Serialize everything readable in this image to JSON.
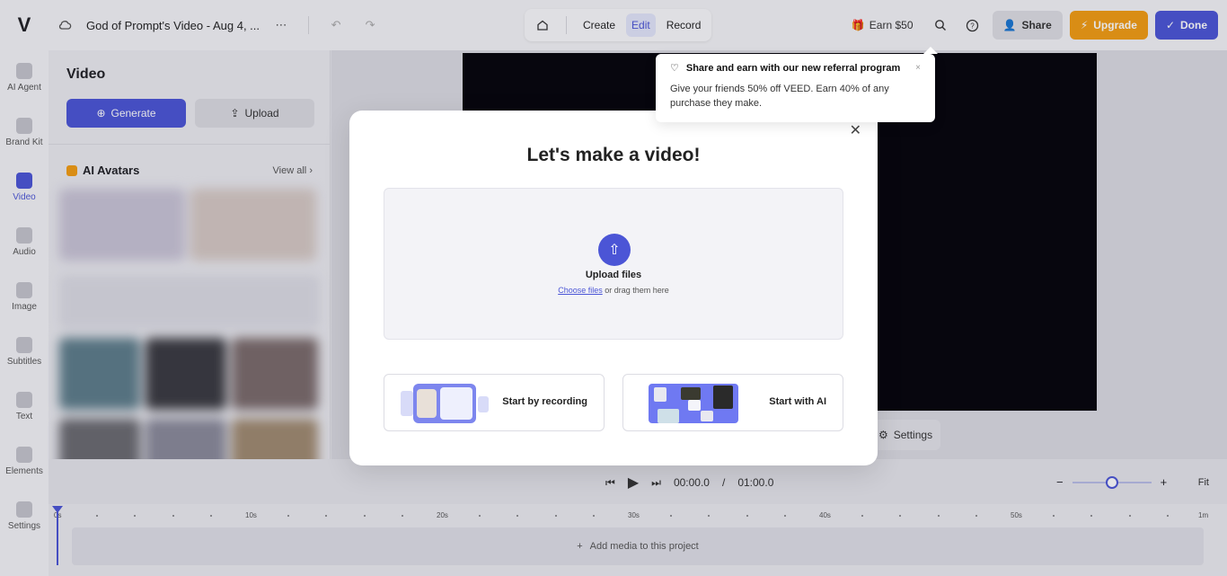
{
  "topbar": {
    "logo": "V",
    "project_title": "God of Prompt's Video - Aug 4, ...",
    "modes": [
      "Create",
      "Edit",
      "Record"
    ],
    "active_mode": "Edit",
    "earn_label": "Earn $50",
    "share_label": "Share",
    "upgrade_label": "Upgrade",
    "done_label": "Done"
  },
  "rail": [
    {
      "label": "AI Agent"
    },
    {
      "label": "Brand Kit"
    },
    {
      "label": "Video"
    },
    {
      "label": "Audio"
    },
    {
      "label": "Image"
    },
    {
      "label": "Subtitles"
    },
    {
      "label": "Text"
    },
    {
      "label": "Elements"
    },
    {
      "label": "Settings"
    }
  ],
  "panel": {
    "title": "Video",
    "generate_label": "Generate",
    "upload_label": "Upload",
    "avatars_title": "AI Avatars",
    "view_all_label": "View all"
  },
  "canvas": {
    "settings_label": "Settings"
  },
  "player": {
    "current_time": "00:00.0",
    "separator": "/",
    "total_time": "01:00.0",
    "fit_label": "Fit",
    "zoom_level": 0.5
  },
  "timeline": {
    "ticks": [
      "0s",
      "10s",
      "20s",
      "30s",
      "40s",
      "50s",
      "1m"
    ],
    "add_media_label": "Add media to this project"
  },
  "modal": {
    "title": "Let's make a video!",
    "upload_title": "Upload files",
    "choose_files_label": "Choose files",
    "drag_text": "or drag them here",
    "start_recording_label": "Start by recording",
    "start_ai_label": "Start with AI"
  },
  "popover": {
    "title": "Share and earn with our new referral program",
    "body": "Give your friends 50% off VEED. Earn 40% of any purchase they make."
  },
  "colors": {
    "accent": "#4b55d6",
    "upgrade": "#f39c12"
  }
}
